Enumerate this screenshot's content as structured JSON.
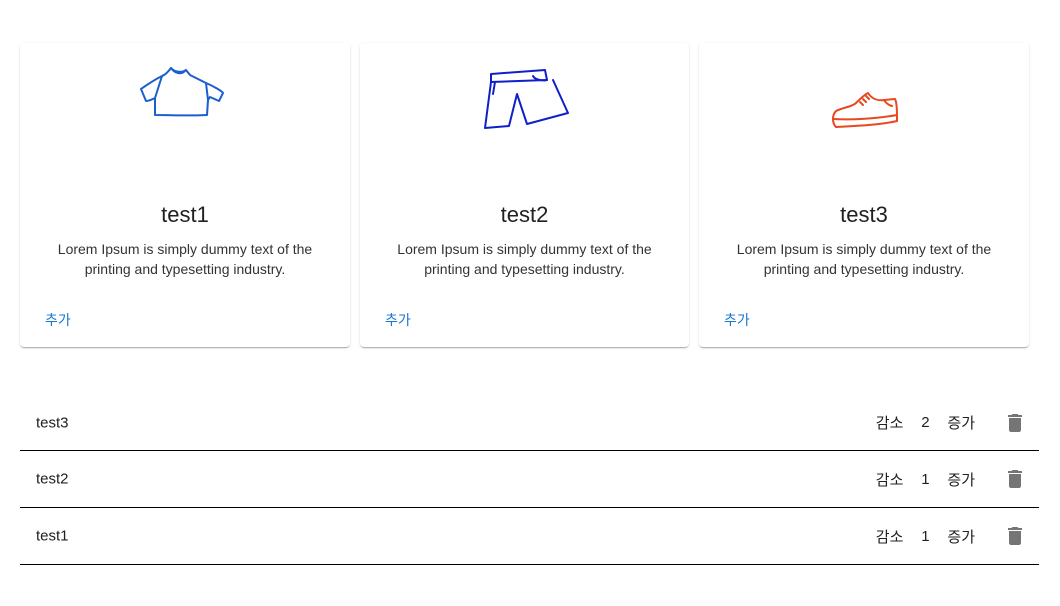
{
  "products": [
    {
      "icon": "tshirt-icon",
      "icon_color": "#1a5fd0",
      "title": "test1",
      "description": "Lorem Ipsum is simply dummy text of the printing and typesetting industry.",
      "add_label": "추가"
    },
    {
      "icon": "shorts-icon",
      "icon_color": "#1020c8",
      "title": "test2",
      "description": "Lorem Ipsum is simply dummy text of the printing and typesetting industry.",
      "add_label": "추가"
    },
    {
      "icon": "sneaker-icon",
      "icon_color": "#e8481e",
      "title": "test3",
      "description": "Lorem Ipsum is simply dummy text of the printing and typesetting industry.",
      "add_label": "추가"
    }
  ],
  "cart": {
    "items": [
      {
        "name": "test3",
        "decrease_label": "감소",
        "quantity": "2",
        "increase_label": "증가",
        "delete_icon": "trash-icon"
      },
      {
        "name": "test2",
        "decrease_label": "감소",
        "quantity": "1",
        "increase_label": "증가",
        "delete_icon": "trash-icon"
      },
      {
        "name": "test1",
        "decrease_label": "감소",
        "quantity": "1",
        "increase_label": "증가",
        "delete_icon": "trash-icon"
      }
    ]
  },
  "colors": {
    "accent": "#1976d2",
    "trash_icon": "#757575",
    "divider": "#000000"
  }
}
